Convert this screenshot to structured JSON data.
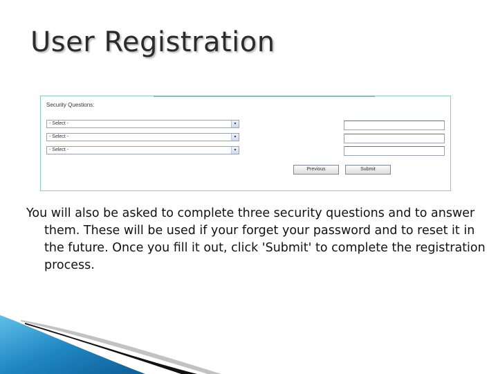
{
  "slide": {
    "title": "User Registration",
    "body_text": "You will also be asked to complete three security questions and to answer them.  These will be used if your forget your password and to reset it in the future.  Once you fill it out, click 'Submit' to complete the registration process."
  },
  "form": {
    "section_heading": "Security Questions:",
    "questions": [
      {
        "selected": "- Select -"
      },
      {
        "selected": "- Select -"
      },
      {
        "selected": "- Select -"
      }
    ],
    "answers": [
      {
        "value": ""
      },
      {
        "value": ""
      },
      {
        "value": ""
      }
    ],
    "previous_label": "Previous",
    "submit_label": "Submit"
  },
  "colors": {
    "panel_border": "#8fc9c7",
    "decoration_blue": "#1e7fb8",
    "decoration_black": "#111111"
  }
}
